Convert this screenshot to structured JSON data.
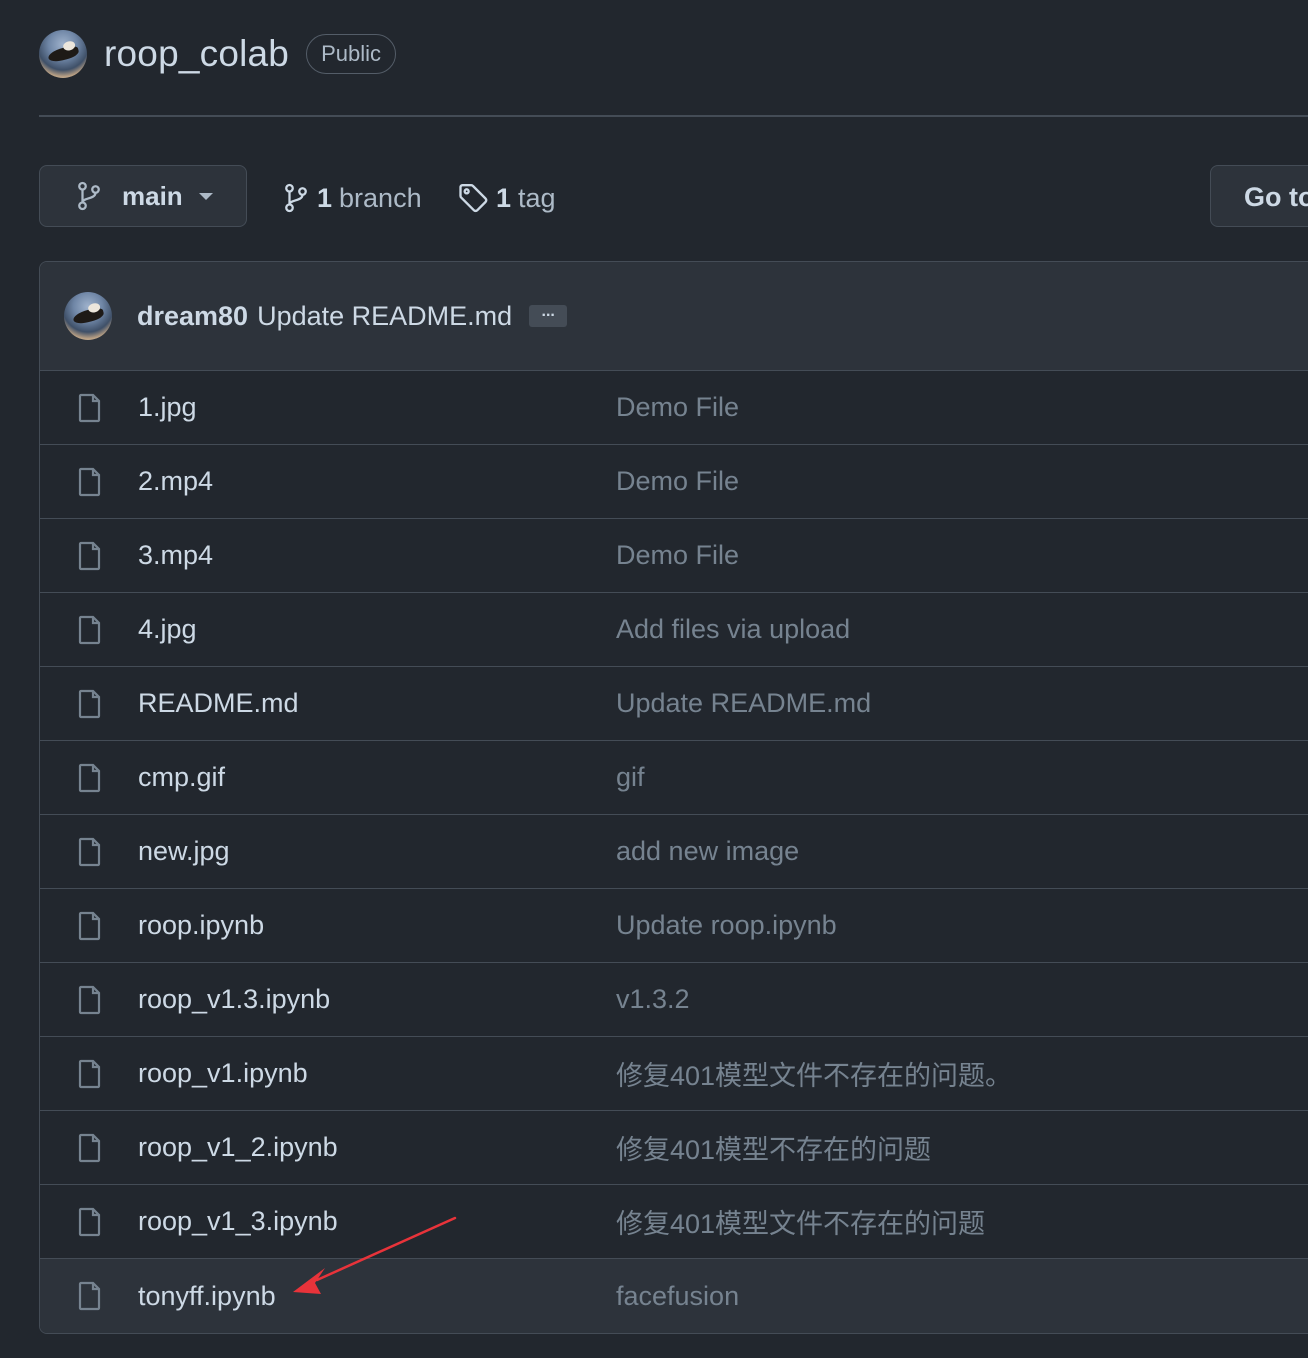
{
  "repo": {
    "name": "roop_colab",
    "visibility": "Public"
  },
  "toolbar": {
    "branch_label": "main",
    "branches_count": "1",
    "branches_label": "branch",
    "tags_count": "1",
    "tags_label": "tag",
    "go_to_file_label": "Go to"
  },
  "commit": {
    "author": "dream80",
    "message": "Update README.md",
    "expand_label": "..."
  },
  "files": [
    {
      "name": "1.jpg",
      "message": "Demo File"
    },
    {
      "name": "2.mp4",
      "message": "Demo File"
    },
    {
      "name": "3.mp4",
      "message": "Demo File"
    },
    {
      "name": "4.jpg",
      "message": "Add files via upload"
    },
    {
      "name": "README.md",
      "message": "Update README.md"
    },
    {
      "name": "cmp.gif",
      "message": "gif"
    },
    {
      "name": "new.jpg",
      "message": "add new image"
    },
    {
      "name": "roop.ipynb",
      "message": "Update roop.ipynb"
    },
    {
      "name": "roop_v1.3.ipynb",
      "message": "v1.3.2"
    },
    {
      "name": "roop_v1.ipynb",
      "message": "修复401模型文件不存在的问题。"
    },
    {
      "name": "roop_v1_2.ipynb",
      "message": "修复401模型不存在的问题"
    },
    {
      "name": "roop_v1_3.ipynb",
      "message": "修复401模型文件不存在的问题"
    },
    {
      "name": "tonyff.ipynb",
      "message": "facefusion"
    }
  ],
  "icons": {
    "branch": "git-branch-icon",
    "tag": "tag-icon",
    "file": "file-icon",
    "caret": "triangle-down-icon"
  },
  "colors": {
    "background": "#22272e",
    "panel": "#2d333b",
    "border": "#444c56",
    "text_primary": "#cdd9e5",
    "text_muted": "#768390",
    "annotation": "#e8333a"
  }
}
